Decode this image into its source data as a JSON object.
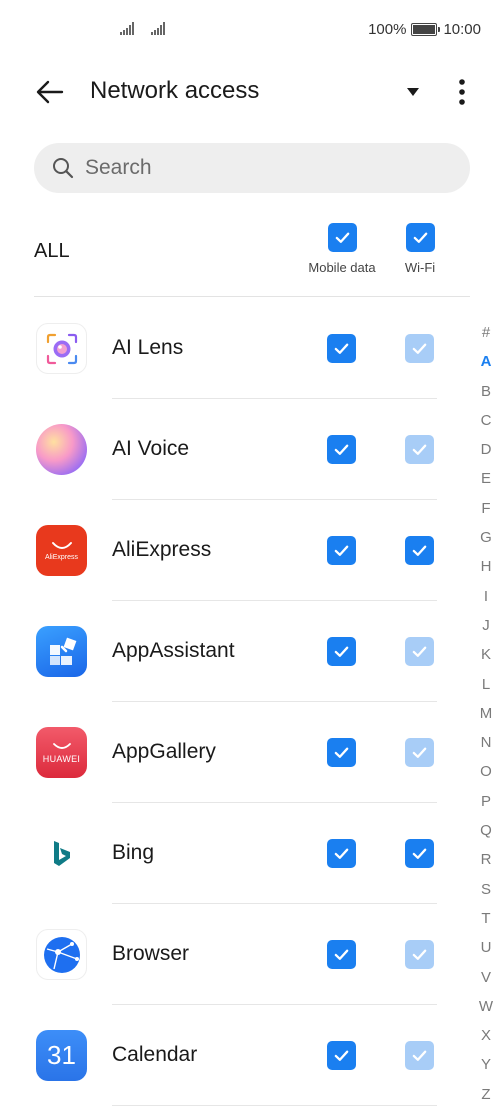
{
  "status_bar": {
    "battery": "100%",
    "time": "10:00"
  },
  "header": {
    "title": "Network access"
  },
  "search": {
    "placeholder": "Search"
  },
  "all_row": {
    "label": "ALL",
    "mobile_label": "Mobile data",
    "wifi_label": "Wi-Fi",
    "mobile_checked": true,
    "wifi_checked": true
  },
  "apps": [
    {
      "name": "AI Lens",
      "mobile": "checked",
      "wifi": "checked-disabled"
    },
    {
      "name": "AI Voice",
      "mobile": "checked",
      "wifi": "checked-disabled"
    },
    {
      "name": "AliExpress",
      "mobile": "checked",
      "wifi": "checked",
      "icon_text": "AliExpress"
    },
    {
      "name": "AppAssistant",
      "mobile": "checked",
      "wifi": "checked-disabled"
    },
    {
      "name": "AppGallery",
      "mobile": "checked",
      "wifi": "checked-disabled",
      "icon_text": "HUAWEI"
    },
    {
      "name": "Bing",
      "mobile": "checked",
      "wifi": "checked"
    },
    {
      "name": "Browser",
      "mobile": "checked",
      "wifi": "checked-disabled"
    },
    {
      "name": "Calendar",
      "mobile": "checked",
      "wifi": "checked-disabled",
      "icon_text": "31"
    }
  ],
  "index": [
    "#",
    "A",
    "B",
    "C",
    "D",
    "E",
    "F",
    "G",
    "H",
    "I",
    "J",
    "K",
    "L",
    "M",
    "N",
    "O",
    "P",
    "Q",
    "R",
    "S",
    "T",
    "U",
    "V",
    "W",
    "X",
    "Y",
    "Z"
  ],
  "active_index": "A",
  "colors": {
    "accent": "#1a7ff0",
    "accent_disabled": "#a8cdf7"
  }
}
